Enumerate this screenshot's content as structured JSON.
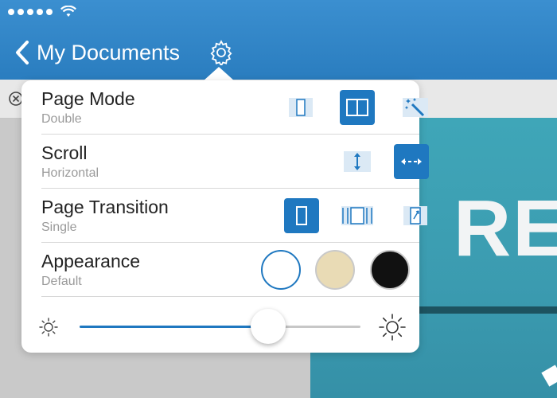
{
  "nav": {
    "back_label": "My Documents",
    "gear_icon": "gear-icon",
    "back_icon": "chevron-left-icon"
  },
  "document": {
    "visible_text": "RE"
  },
  "colors": {
    "accent": "#1f78c0",
    "navbar": "#2e82c6",
    "page_teal": "#3ba0b4"
  },
  "settings": {
    "page_mode": {
      "title": "Page Mode",
      "value": "Double",
      "options": [
        {
          "icon": "single-page-icon",
          "selected": false
        },
        {
          "icon": "double-page-icon",
          "selected": true
        },
        {
          "icon": "magic-wand-icon",
          "selected": false
        }
      ]
    },
    "scroll": {
      "title": "Scroll",
      "value": "Horizontal",
      "options": [
        {
          "icon": "vertical-scroll-icon",
          "selected": false
        },
        {
          "icon": "horizontal-scroll-icon",
          "selected": true
        }
      ]
    },
    "page_transition": {
      "title": "Page Transition",
      "value": "Single",
      "options": [
        {
          "icon": "single-transition-icon",
          "selected": true
        },
        {
          "icon": "continuous-transition-icon",
          "selected": false
        },
        {
          "icon": "page-curl-icon",
          "selected": false
        }
      ]
    },
    "appearance": {
      "title": "Appearance",
      "value": "Default",
      "options": [
        {
          "name": "white-theme",
          "color": "#ffffff",
          "selected": true
        },
        {
          "name": "sepia-theme",
          "color": "#e9dbb5",
          "selected": false
        },
        {
          "name": "night-theme",
          "color": "#111111",
          "selected": false
        }
      ]
    },
    "brightness": {
      "level_percent": 67,
      "min_icon": "sun-dim-icon",
      "max_icon": "sun-bright-icon"
    }
  }
}
